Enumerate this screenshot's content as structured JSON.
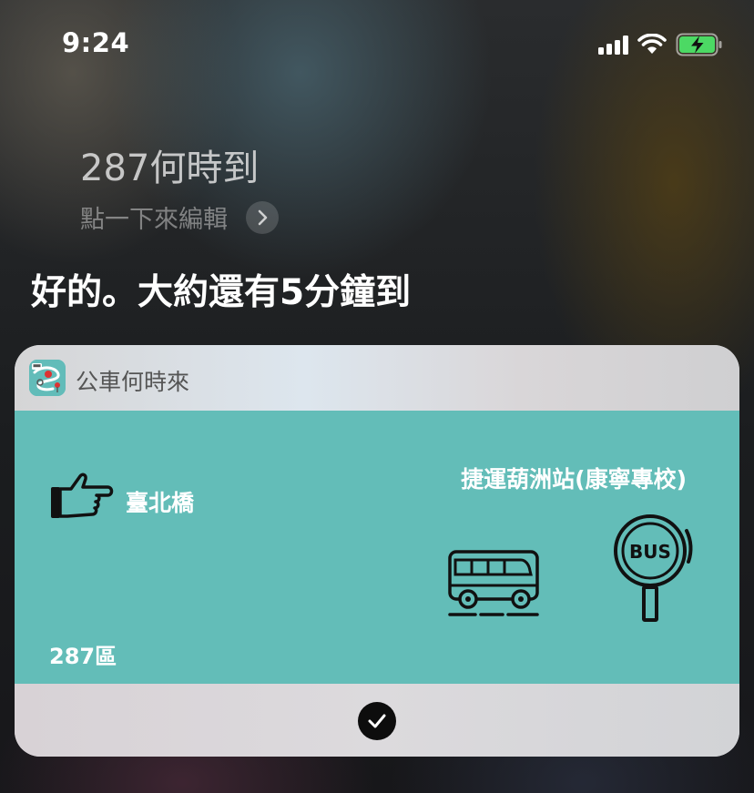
{
  "status_bar": {
    "time": "9:24",
    "icons": [
      "cellular-signal-icon",
      "wifi-icon",
      "battery-charging-icon"
    ],
    "battery_color": "#4cd964"
  },
  "siri": {
    "query": "287何時到",
    "edit_hint": "點一下來編輯",
    "reply": "好的。大約還有5分鐘到"
  },
  "card": {
    "app_name": "公車何時來",
    "app_icon": "bus-app-icon",
    "accent_color": "#63bdb8",
    "from_stop": "臺北橋",
    "to_stop": "捷運葫洲站(康寧專校)",
    "route": "287區",
    "bus_stop_sign": "BUS",
    "icons": [
      "pointing-hand-icon",
      "bus-icon",
      "bus-stop-sign-icon",
      "checkmark-icon"
    ]
  }
}
